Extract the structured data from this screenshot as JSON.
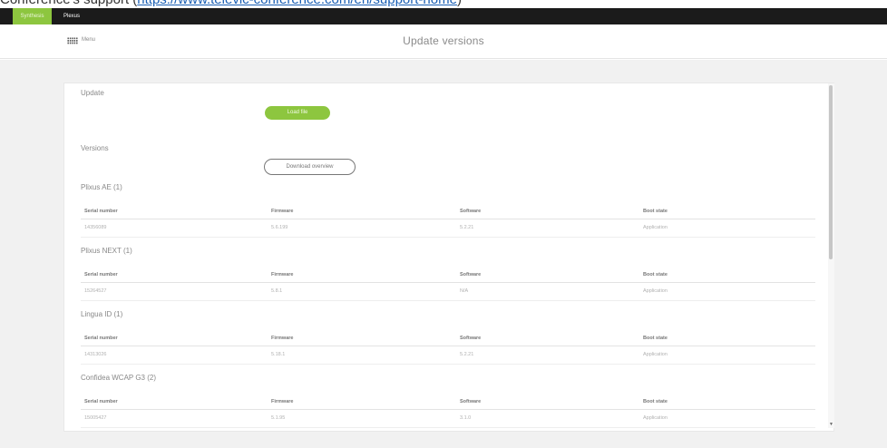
{
  "caption": {
    "prefix": "Conference's support (",
    "link": "https://www.televic-conference.com/en/support-home",
    "suffix": ")"
  },
  "topbar": {
    "tabs": [
      {
        "label": "Synthesis"
      },
      {
        "label": "Plexus"
      }
    ]
  },
  "header": {
    "menu_label": "Menu",
    "title": "Update versions"
  },
  "panel": {
    "update_label": "Update",
    "load_button": "Load file",
    "versions_label": "Versions",
    "download_button": "Download overview",
    "columns": [
      "Serial number",
      "Firmware",
      "Software",
      "Boot state"
    ],
    "groups": [
      {
        "title": "Plixus AE (1)",
        "rows": [
          [
            "14356089",
            "5.6.199",
            "5.2.21",
            "Application"
          ]
        ]
      },
      {
        "title": "Plixus NEXT (1)",
        "rows": [
          [
            "15264527",
            "5.8.1",
            "N/A",
            "Application"
          ]
        ]
      },
      {
        "title": "Lingua ID (1)",
        "rows": [
          [
            "14313026",
            "5.18.1",
            "5.2.21",
            "Application"
          ]
        ]
      },
      {
        "title": "Confidea WCAP G3 (2)",
        "rows": [
          [
            "15005427",
            "5.1.95",
            "3.1.0",
            "Application"
          ]
        ]
      }
    ]
  },
  "colors": {
    "accent": "#8dc63f",
    "topbar": "#1b1b1b",
    "canvas": "#f1f1f1"
  },
  "icons": {
    "menu": "grid-menu-icon",
    "scroll_down": "arrow-down-icon"
  }
}
